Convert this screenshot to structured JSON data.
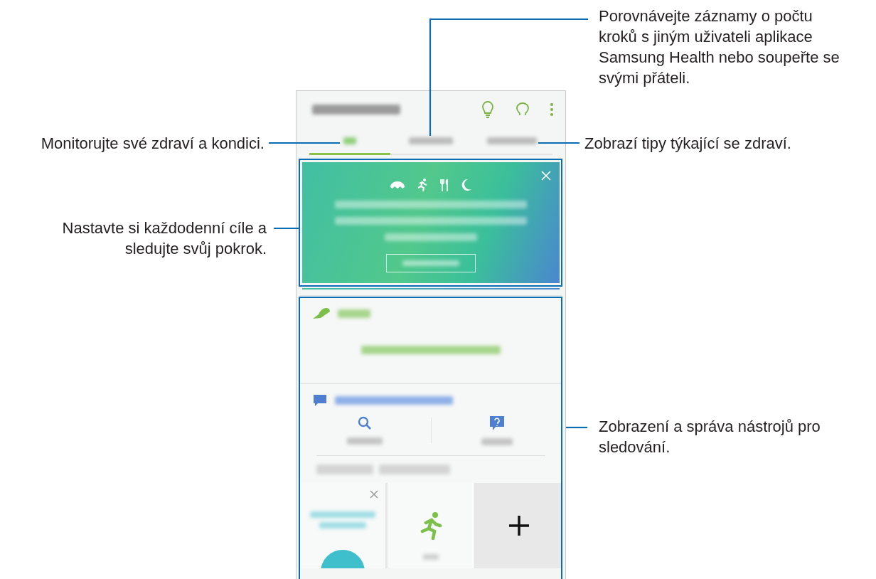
{
  "callouts": [
    {
      "text": "Porovnávejte záznamy o počtu kroků s jiným uživateli aplikace Samsung Health nebo soupeřte se svými přáteli."
    },
    {
      "text": "Monitorujte své zdraví a kondici."
    },
    {
      "text": "Zobrazí tipy týkající se zdraví."
    },
    {
      "text": "Nastavte si každodenní cíle a sledujte svůj pokrok."
    },
    {
      "text": "Zobrazení a správa nástrojů pro sledování."
    }
  ],
  "tabs": [
    {
      "selected": true
    },
    {
      "selected": false
    },
    {
      "selected": false
    }
  ]
}
